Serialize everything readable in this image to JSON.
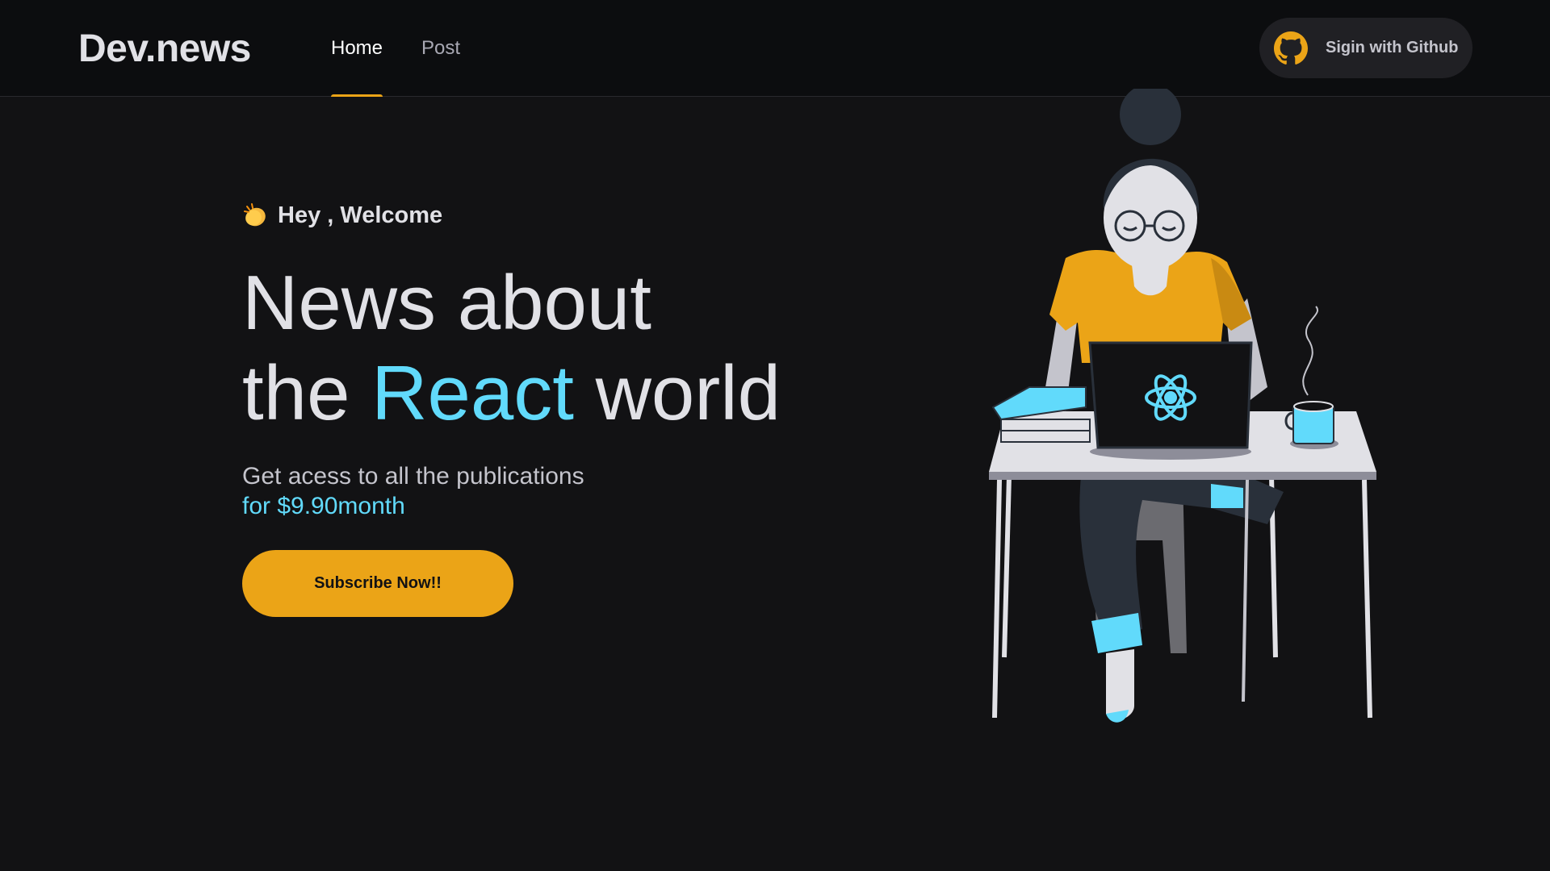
{
  "header": {
    "logo": "Dev.news",
    "nav": [
      {
        "label": "Home",
        "active": true
      },
      {
        "label": "Post",
        "active": false
      }
    ],
    "signin_label": "Sigin with Github"
  },
  "hero": {
    "welcome": "Hey , Welcome",
    "headline_line1": "News about",
    "headline_the": "the",
    "headline_react": "React",
    "headline_world": "world",
    "sub_line1": "Get acess to all the publications",
    "sub_price": "for $9.90month",
    "cta_label": "Subscribe Now!!"
  },
  "icons": {
    "github": "github-icon",
    "clap": "clapping-hands-icon",
    "illustration": "woman-at-laptop-illustration"
  },
  "colors": {
    "background": "#121214",
    "header_bg": "#0c0d0f",
    "accent_yellow": "#eba417",
    "accent_cyan": "#61dafb"
  }
}
